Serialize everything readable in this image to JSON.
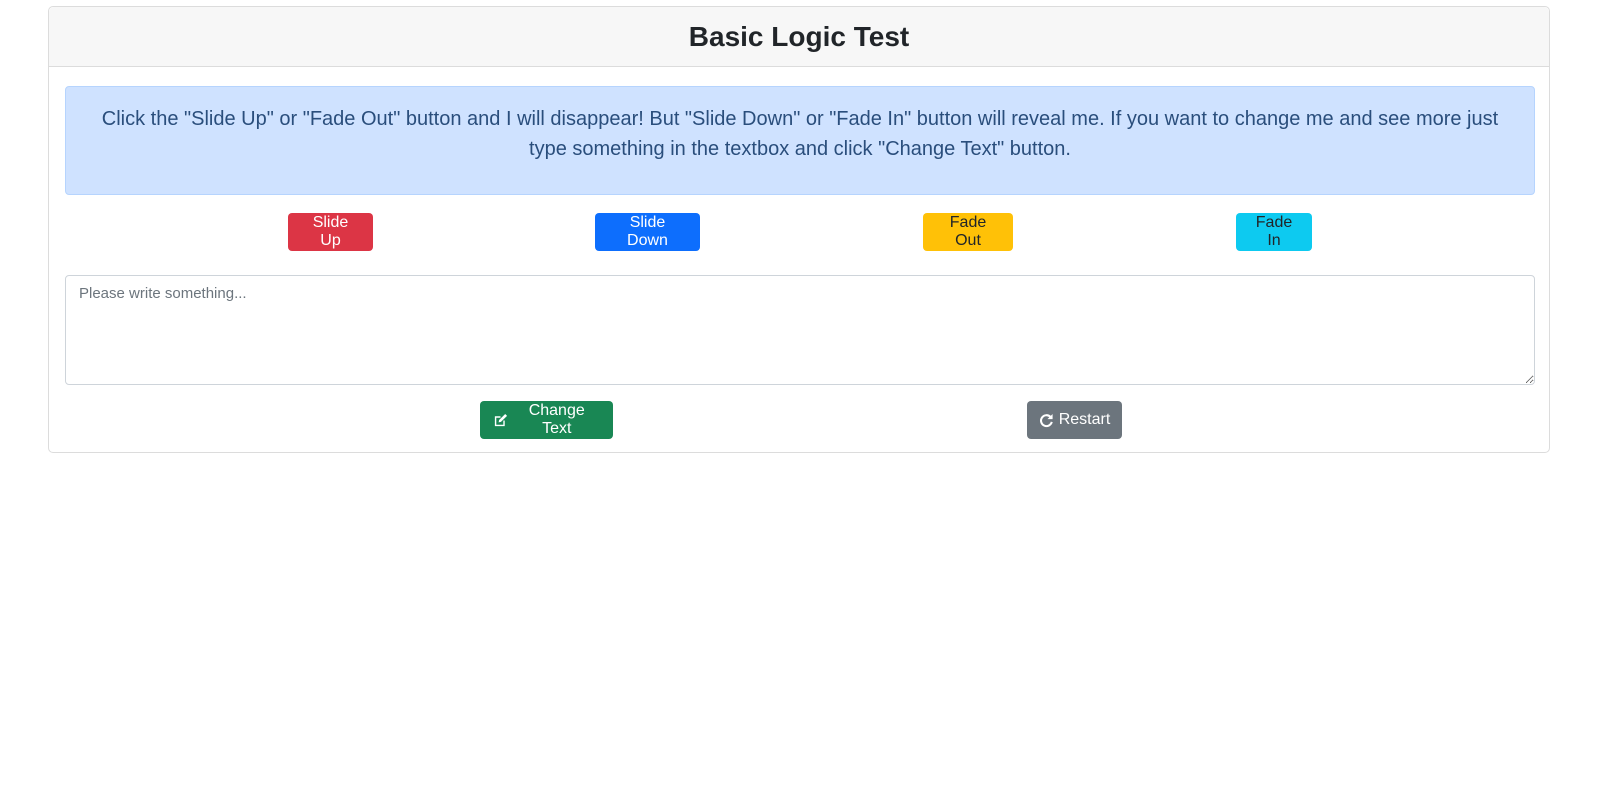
{
  "header": {
    "title": "Basic Logic Test"
  },
  "alert": {
    "text": "Click the \"Slide Up\" or \"Fade Out\" button and I will disappear! But \"Slide Down\" or \"Fade In\" button will reveal me. If you want to change me and see more just type something in the textbox and click \"Change Text\" button."
  },
  "buttons": {
    "slide_up": "Slide Up",
    "slide_down": "Slide Down",
    "fade_out": "Fade Out",
    "fade_in": "Fade In",
    "change_text": "Change Text",
    "restart": "Restart"
  },
  "textbox": {
    "placeholder": "Please write something...",
    "value": ""
  },
  "icons": {
    "change_text": "edit-icon",
    "restart": "redo-icon"
  },
  "colors": {
    "danger": "#dc3545",
    "primary": "#0d6efd",
    "warning": "#ffc107",
    "info": "#0dcaf0",
    "success": "#198754",
    "secondary": "#6c757d",
    "alert_bg": "#cfe2ff"
  }
}
